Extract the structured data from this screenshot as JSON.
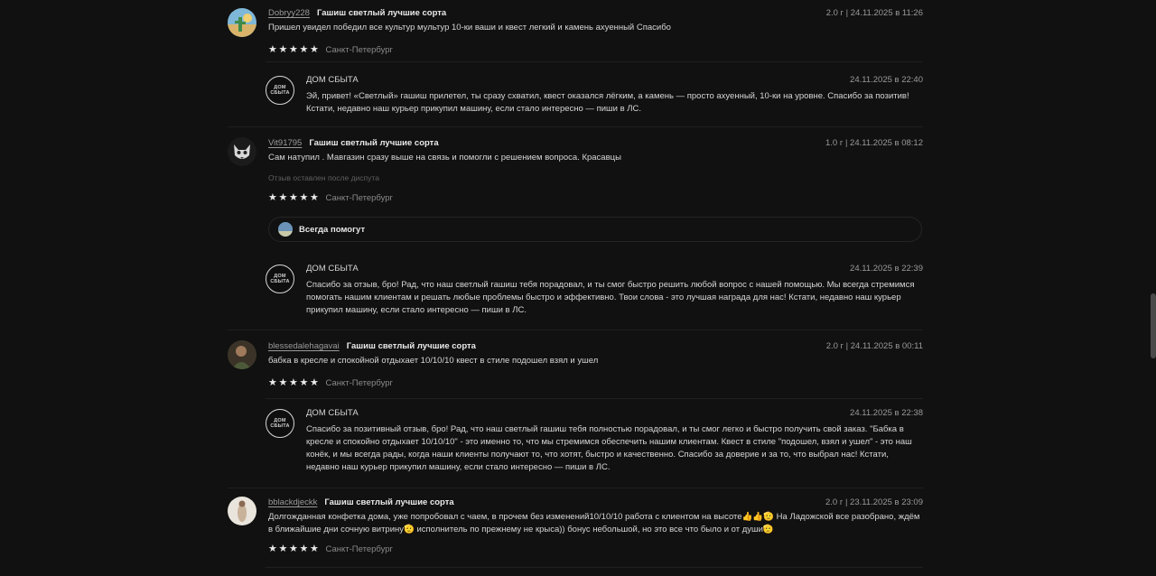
{
  "shop": {
    "name": "ДОМ СБЫТА",
    "logo_line1": "ДОМ",
    "logo_line2": "СБЫТА"
  },
  "reviews": [
    {
      "username": "Dobryy228",
      "product": "Гашиш светлый лучшие сорта",
      "meta": "2.0 г | 24.11.2025 в 11:26",
      "text": "Пришел увидел победил все культур мультур 10-ки ваши и квест легкий и камень ахуенный Спасибо",
      "city": "Санкт-Петербург",
      "rating": 5,
      "reply": {
        "date": "24.11.2025 в 22:40",
        "text": "Эй, привет! «Светлый» гашиш прилетел, ты сразу схватил, квест оказался лёгким, а камень — просто ахуенный, 10-ки на уровне. Спасибо за позитив! Кстати, недавно наш курьер прикупил машину, если стало интересно — пиши в ЛС."
      }
    },
    {
      "username": "Vit91795",
      "product": "Гашиш светлый лучшие сорта",
      "meta": "1.0 г | 24.11.2025 в 08:12",
      "text": "Сам натупил . Мавгазин сразу выше на связь и помогли с решением вопроса. Красавцы",
      "note": "Отзыв оставлен после диспута",
      "city": "Санкт-Петербург",
      "rating": 5,
      "pill": "Всегда помогут",
      "reply": {
        "date": "24.11.2025 в 22:39",
        "text": "Спасибо за отзыв, бро! Рад, что наш светлый гашиш тебя порадовал, и ты смог быстро решить любой вопрос с нашей помощью. Мы всегда стремимся помогать нашим клиентам и решать любые проблемы быстро и эффективно. Твои слова - это лучшая награда для нас! Кстати, недавно наш курьер прикупил машину, если стало интересно — пиши в ЛС."
      }
    },
    {
      "username": "blessedalehagavai",
      "product": "Гашиш светлый лучшие сорта",
      "meta": "2.0 г | 24.11.2025 в 00:11",
      "text": "бабка в кресле и спокойной отдыхает 10/10/10 квест в стиле подошел взял и ушел",
      "city": "Санкт-Петербург",
      "rating": 5,
      "reply": {
        "date": "24.11.2025 в 22:38",
        "text": "Спасибо за позитивный отзыв, бро! Рад, что наш светлый гашиш тебя полностью порадовал, и ты смог легко и быстро получить свой заказ. \"Бабка в кресле и спокойно отдыхает 10/10/10\" - это именно то, что мы стремимся обеспечить нашим клиентам. Квест в стиле \"подошел, взял и ушел\" - это наш конёк, и мы всегда рады, когда наши клиенты получают то, что хотят, быстро и качественно. Спасибо за доверие и за то, что выбрал нас! Кстати, недавно наш курьер прикупил машину, если стало интересно — пиши в ЛС."
      }
    },
    {
      "username": "bblackdjeckk",
      "product": "Гашиш светлый лучшие сорта",
      "meta": "2.0 г | 23.11.2025 в 23:09",
      "text": "Долгожданная конфетка дома, уже попробовал с чаем, в прочем без изменений10/10/10 работа с клиентом на высоте👍👍🫡 На Ладожской все разобрано, ждём в ближайшие дни сочную витрину🫡 исполнитель по прежнему не крыса)) бонус небольшой, но это все что было и от души🫡",
      "city": "Санкт-Петербург",
      "rating": 5
    }
  ],
  "icons": {
    "star": "star-icon",
    "scrollbar": "scrollbar-thumb"
  }
}
